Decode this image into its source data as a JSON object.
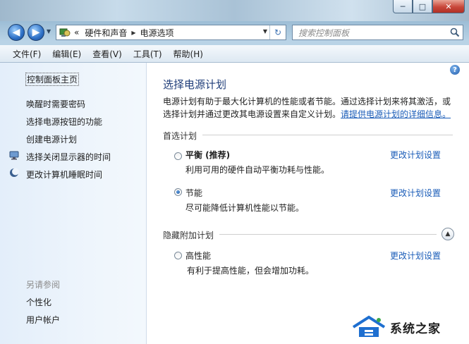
{
  "window": {
    "controls": {
      "minimize": "─",
      "maximize": "□",
      "close": "✕"
    }
  },
  "nav": {
    "back_icon": "back-arrow-icon",
    "forward_icon": "forward-arrow-icon",
    "overflow": "«",
    "breadcrumbs": [
      "硬件和声音",
      "电源选项"
    ],
    "search_placeholder": "搜索控制面板"
  },
  "menu": [
    "文件(F)",
    "编辑(E)",
    "查看(V)",
    "工具(T)",
    "帮助(H)"
  ],
  "sidebar": {
    "home": "控制面板主页",
    "links": [
      "唤醒时需要密码",
      "选择电源按钮的功能",
      "创建电源计划",
      "选择关闭显示器的时间",
      "更改计算机睡眠时间"
    ],
    "see_also_title": "另请参阅",
    "see_also": [
      "个性化",
      "用户帐户"
    ]
  },
  "main": {
    "title": "选择电源计划",
    "description": "电源计划有助于最大化计算机的性能或者节能。通过选择计划来将其激活，或选择计划并通过更改其电源设置来自定义计划。",
    "more_info_link": "请提供电源计划的详细信息。",
    "preferred_section": "首选计划",
    "hidden_section": "隐藏附加计划",
    "change_link": "更改计划设置",
    "plans": [
      {
        "name": "平衡 (推荐)",
        "desc": "利用可用的硬件自动平衡功耗与性能。",
        "selected": false
      },
      {
        "name": "节能",
        "desc": "尽可能降低计算机性能以节能。",
        "selected": true
      },
      {
        "name": "高性能",
        "desc": "有利于提高性能，但会增加功耗。",
        "selected": false
      }
    ]
  },
  "watermark": {
    "text": "系统之家"
  },
  "colors": {
    "link": "#1a5cb8",
    "title": "#1f3d79",
    "pane": "#e8f1fb"
  }
}
